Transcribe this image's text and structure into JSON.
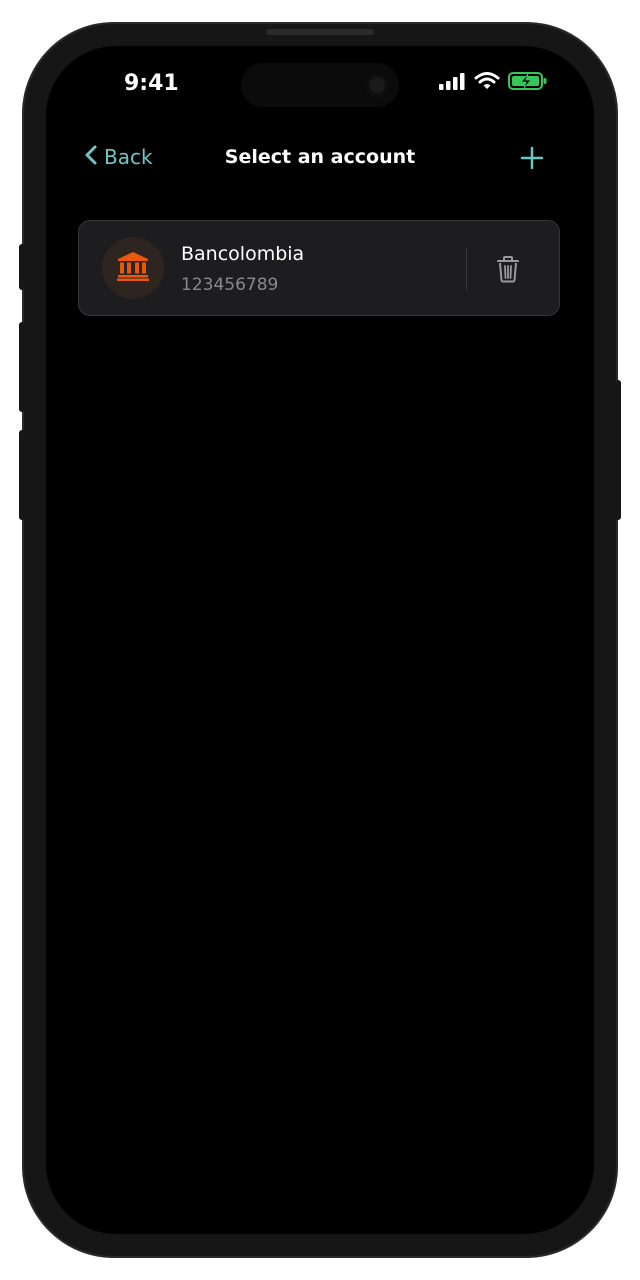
{
  "status_bar": {
    "time": "9:41"
  },
  "nav": {
    "back_label": "Back",
    "title": "Select an account",
    "add_icon": "plus-icon",
    "back_icon": "chevron-left-icon"
  },
  "accounts": [
    {
      "bank_name": "Bancolombia",
      "account_number": "123456789",
      "icon": "bank-icon",
      "action_icon": "trash-icon"
    }
  ],
  "colors": {
    "accent": "#6fc7c3",
    "bank_icon": "#e8590c",
    "battery": "#35c759"
  }
}
